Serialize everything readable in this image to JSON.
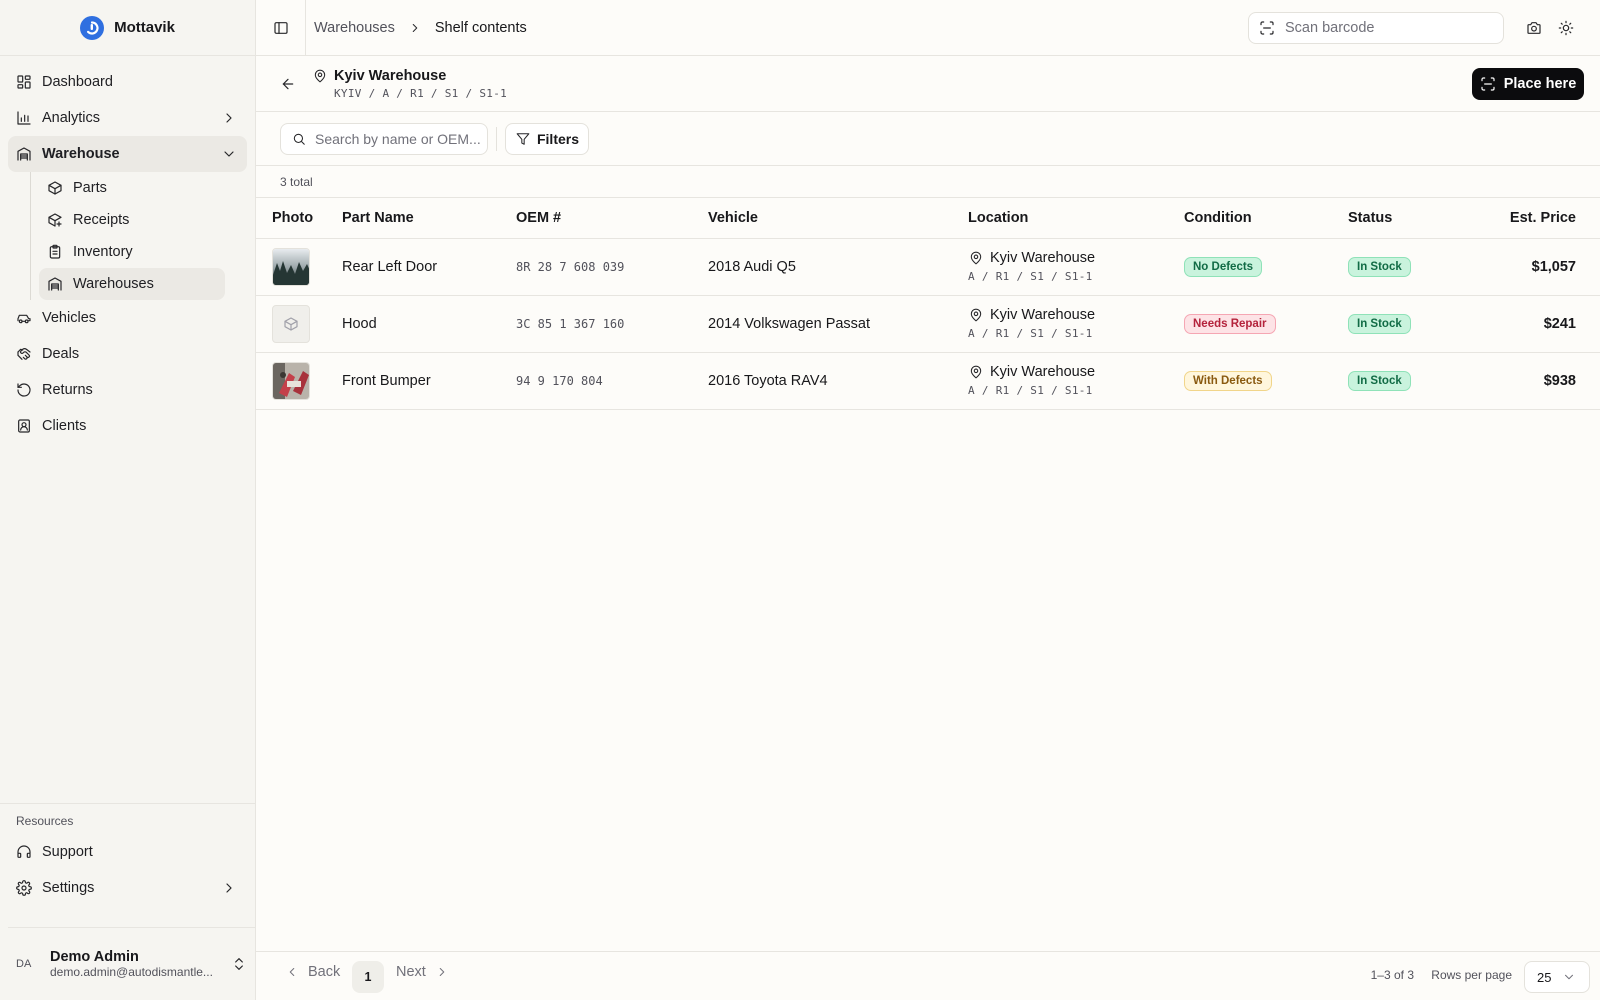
{
  "brand": {
    "name": "Mottavik",
    "color": "#2f6fe0"
  },
  "sidebar": {
    "items": [
      {
        "label": "Dashboard",
        "icon": "dashboard-icon"
      },
      {
        "label": "Analytics",
        "icon": "chart-icon"
      },
      {
        "label": "Warehouse",
        "icon": "warehouse-icon"
      },
      {
        "label": "Vehicles",
        "icon": "car-icon"
      },
      {
        "label": "Deals",
        "icon": "handshake-icon"
      },
      {
        "label": "Returns",
        "icon": "return-icon"
      },
      {
        "label": "Clients",
        "icon": "contact-icon"
      }
    ],
    "warehouse_sub": [
      {
        "label": "Parts",
        "icon": "box-icon"
      },
      {
        "label": "Receipts",
        "icon": "box-plus-icon"
      },
      {
        "label": "Inventory",
        "icon": "clipboard-icon"
      },
      {
        "label": "Warehouses",
        "icon": "warehouse-icon"
      }
    ],
    "resources_label": "Resources",
    "resources": [
      {
        "label": "Support",
        "icon": "headset-icon"
      },
      {
        "label": "Settings",
        "icon": "gear-icon"
      }
    ],
    "user": {
      "initials": "DA",
      "name": "Demo Admin",
      "email": "demo.admin@autodismantle..."
    }
  },
  "topbar": {
    "breadcrumb": [
      "Warehouses",
      "Shelf contents"
    ],
    "scan_placeholder": "Scan barcode"
  },
  "header": {
    "title": "Kyiv Warehouse",
    "path": "KYIV / A / R1 / S1 / S1-1",
    "place_label": "Place here"
  },
  "toolbar": {
    "search_placeholder": "Search by name or OEM...",
    "filters_label": "Filters"
  },
  "count_text": "3 total",
  "table": {
    "columns": [
      "Photo",
      "Part Name",
      "OEM #",
      "Vehicle",
      "Location",
      "Condition",
      "Status",
      "Est. Price"
    ],
    "rows": [
      {
        "photo": "forest",
        "name": "Rear Left Door",
        "oem": "8R 28 7 608 039",
        "vehicle": "2018 Audi Q5",
        "loc_name": "Kyiv Warehouse",
        "loc_path": "A / R1 / S1 / S1-1",
        "condition": "No Defects",
        "condition_tone": "green",
        "status": "In Stock",
        "price": "$1,057"
      },
      {
        "photo": "placeholder",
        "name": "Hood",
        "oem": "3C 85 1 367 160",
        "vehicle": "2014 Volkswagen Passat",
        "loc_name": "Kyiv Warehouse",
        "loc_path": "A / R1 / S1 / S1-1",
        "condition": "Needs Repair",
        "condition_tone": "red",
        "status": "In Stock",
        "price": "$241"
      },
      {
        "photo": "bumper",
        "name": "Front Bumper",
        "oem": "94 9 170 804",
        "vehicle": "2016 Toyota RAV4",
        "loc_name": "Kyiv Warehouse",
        "loc_path": "A / R1 / S1 / S1-1",
        "condition": "With Defects",
        "condition_tone": "yellow",
        "status": "In Stock",
        "price": "$938"
      }
    ]
  },
  "footer": {
    "back_label": "Back",
    "page": "1",
    "next_label": "Next",
    "range": "1–3 of 3",
    "rows_label": "Rows per page",
    "rows_value": "25"
  }
}
